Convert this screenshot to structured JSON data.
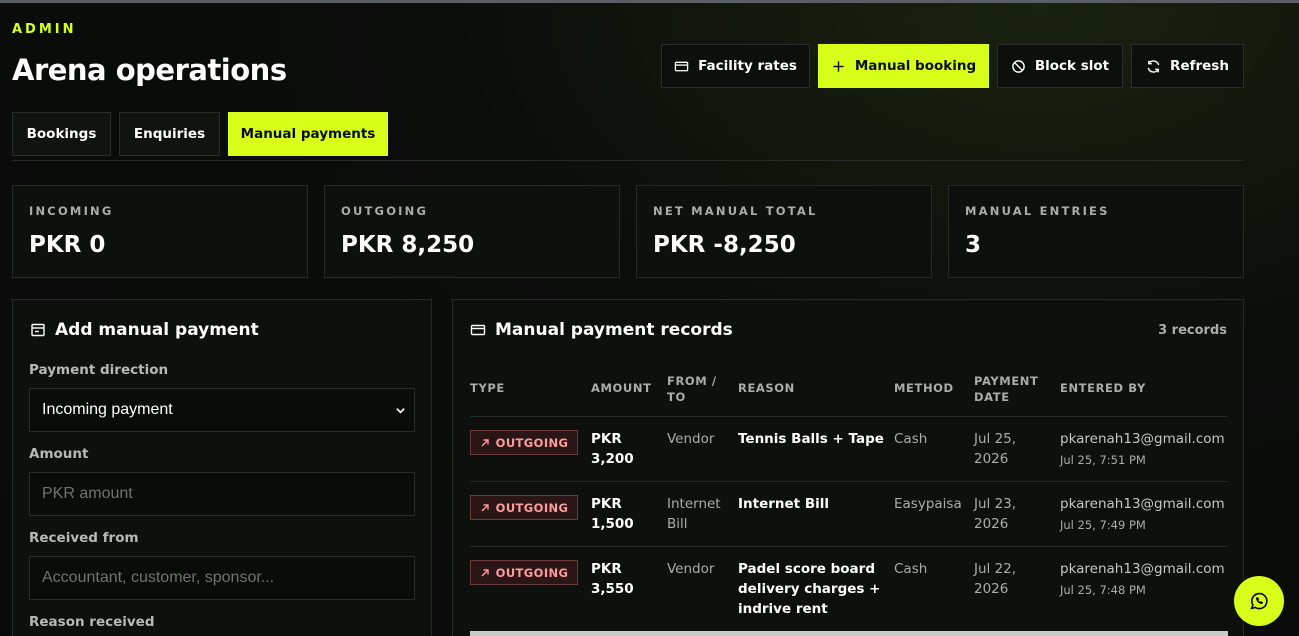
{
  "header": {
    "kicker": "ADMIN",
    "title": "Arena operations"
  },
  "actions": {
    "facility_rates": "Facility rates",
    "manual_booking": "Manual booking",
    "block_slot": "Block slot",
    "refresh": "Refresh"
  },
  "tabs": [
    {
      "label": "Bookings",
      "active": false
    },
    {
      "label": "Enquiries",
      "active": false
    },
    {
      "label": "Manual payments",
      "active": true
    }
  ],
  "stats": [
    {
      "label": "INCOMING",
      "value": "PKR 0"
    },
    {
      "label": "OUTGOING",
      "value": "PKR 8,250"
    },
    {
      "label": "NET MANUAL TOTAL",
      "value": "PKR -8,250"
    },
    {
      "label": "MANUAL ENTRIES",
      "value": "3"
    }
  ],
  "form": {
    "title": "Add manual payment",
    "direction_label": "Payment direction",
    "direction_value": "Incoming payment",
    "amount_label": "Amount",
    "amount_placeholder": "PKR amount",
    "from_label": "Received from",
    "from_placeholder": "Accountant, customer, sponsor...",
    "reason_label": "Reason received"
  },
  "records": {
    "title": "Manual payment records",
    "count": "3 records",
    "columns": {
      "type": "TYPE",
      "amount": "AMOUNT",
      "from_to_1": "FROM /",
      "from_to_2": "TO",
      "reason": "REASON",
      "method": "METHOD",
      "date_1": "PAYMENT",
      "date_2": "DATE",
      "entered_by": "ENTERED BY"
    },
    "rows": [
      {
        "type": "OUTGOING",
        "amount_1": "PKR",
        "amount_2": "3,200",
        "from_1": "Vendor",
        "from_2": "",
        "reason_1": "Tennis Balls + Tape",
        "reason_2": "",
        "reason_3": "",
        "method": "Cash",
        "date_1": "Jul 25,",
        "date_2": "2026",
        "by": "pkarenah13@gmail.com",
        "by_time": "Jul 25, 7:51 PM"
      },
      {
        "type": "OUTGOING",
        "amount_1": "PKR",
        "amount_2": "1,500",
        "from_1": "Internet",
        "from_2": "Bill",
        "reason_1": "Internet Bill",
        "reason_2": "",
        "reason_3": "",
        "method": "Easypaisa",
        "date_1": "Jul 23,",
        "date_2": "2026",
        "by": "pkarenah13@gmail.com",
        "by_time": "Jul 25, 7:49 PM"
      },
      {
        "type": "OUTGOING",
        "amount_1": "PKR",
        "amount_2": "3,550",
        "from_1": "Vendor",
        "from_2": "",
        "reason_1": "Padel score board",
        "reason_2": "delivery charges +",
        "reason_3": "indrive rent",
        "method": "Cash",
        "date_1": "Jul 22,",
        "date_2": "2026",
        "by": "pkarenah13@gmail.com",
        "by_time": "Jul 25, 7:48 PM"
      }
    ]
  },
  "colors": {
    "accent": "#d8ff1a",
    "background": "#0b0d0b",
    "outgoing": "#ff9c9c"
  }
}
